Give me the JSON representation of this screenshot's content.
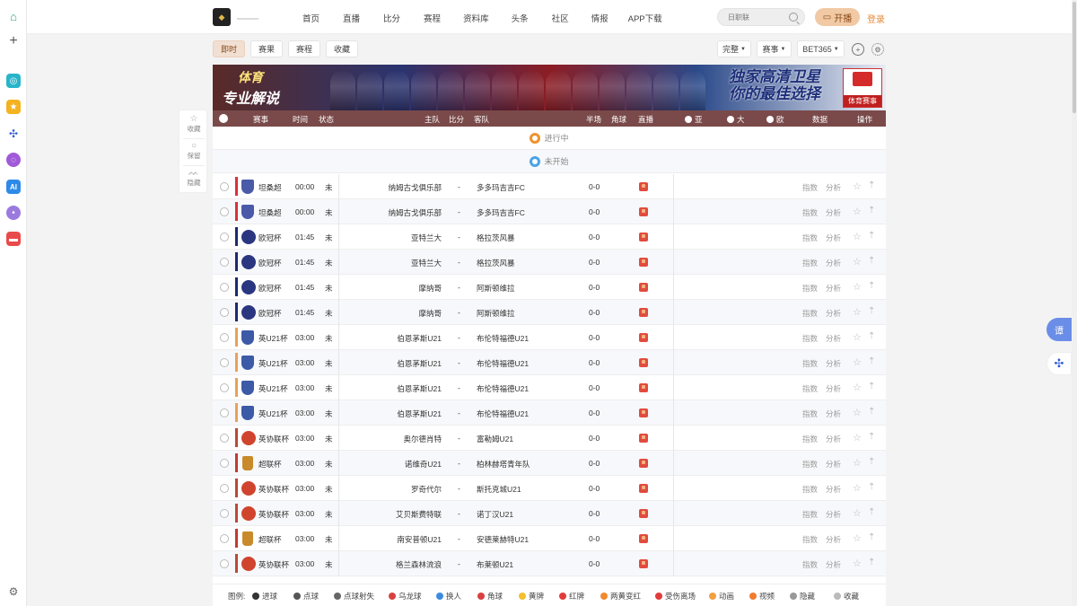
{
  "nav": [
    "首页",
    "直播",
    "比分",
    "赛程",
    "资料库",
    "头条",
    "社区",
    "情报",
    "APP下载"
  ],
  "search_placeholder": "日职联",
  "open_label": "开播",
  "login_label": "登录",
  "tabs": [
    "即时",
    "赛果",
    "赛程",
    "收藏"
  ],
  "selects": [
    "完整",
    "赛事",
    "BET365"
  ],
  "banner": {
    "left_top": "体育",
    "left_bottom": "专业解说",
    "right_line1": "独家高清卫星",
    "right_line2": "你的最佳选择",
    "brand": "体育赛事"
  },
  "header": {
    "league": "赛事",
    "time": "时间",
    "status": "状态",
    "home": "主队",
    "score": "比分",
    "away": "客队",
    "half": "半场",
    "corner": "角球",
    "live": "直播",
    "asia": "亚",
    "big": "大",
    "euro": "欧",
    "data": "数据",
    "ops": "操作"
  },
  "sections": {
    "live": "进行中",
    "upcoming": "未开始"
  },
  "row_common": {
    "status": "未",
    "score": "-",
    "half": "0-0",
    "index": "指数",
    "analysis": "分析"
  },
  "rows": [
    {
      "league": "坦桑超",
      "time": "00:00",
      "home": "纳姆古戈俱乐部",
      "away": "多多玛吉吉FC",
      "color": "#d8323a",
      "logo": "shield",
      "logo_color": "#4a5aa8"
    },
    {
      "league": "坦桑超",
      "time": "00:00",
      "home": "纳姆古戈俱乐部",
      "away": "多多玛吉吉FC",
      "color": "#d8323a",
      "logo": "shield",
      "logo_color": "#4a5aa8"
    },
    {
      "league": "欧冠杯",
      "time": "01:45",
      "home": "亚特兰大",
      "away": "格拉茨风暴",
      "color": "#1d2a6e",
      "logo": "round",
      "logo_color": "#2a3680"
    },
    {
      "league": "欧冠杯",
      "time": "01:45",
      "home": "亚特兰大",
      "away": "格拉茨风暴",
      "color": "#1d2a6e",
      "logo": "round",
      "logo_color": "#2a3680"
    },
    {
      "league": "欧冠杯",
      "time": "01:45",
      "home": "摩纳哥",
      "away": "阿斯顿维拉",
      "color": "#1d2a6e",
      "logo": "round",
      "logo_color": "#2a3680"
    },
    {
      "league": "欧冠杯",
      "time": "01:45",
      "home": "摩纳哥",
      "away": "阿斯顿维拉",
      "color": "#1d2a6e",
      "logo": "round",
      "logo_color": "#2a3680"
    },
    {
      "league": "英U21杯",
      "time": "03:00",
      "home": "伯恩茅斯U21",
      "away": "布伦特福德U21",
      "color": "#e8a25a",
      "logo": "shield",
      "logo_color": "#3d5aa6"
    },
    {
      "league": "英U21杯",
      "time": "03:00",
      "home": "伯恩茅斯U21",
      "away": "布伦特福德U21",
      "color": "#e8a25a",
      "logo": "shield",
      "logo_color": "#3d5aa6"
    },
    {
      "league": "英U21杯",
      "time": "03:00",
      "home": "伯恩茅斯U21",
      "away": "布伦特福德U21",
      "color": "#e8a25a",
      "logo": "shield",
      "logo_color": "#3d5aa6"
    },
    {
      "league": "英U21杯",
      "time": "03:00",
      "home": "伯恩茅斯U21",
      "away": "布伦特福德U21",
      "color": "#e8a25a",
      "logo": "shield",
      "logo_color": "#3d5aa6"
    },
    {
      "league": "英协联杯",
      "time": "03:00",
      "home": "奥尔德肖特",
      "away": "富勒姆U21",
      "color": "#b84a3a",
      "logo": "round",
      "logo_color": "#d0442e"
    },
    {
      "league": "超联杯",
      "time": "03:00",
      "home": "诺维奇U21",
      "away": "柏林赫塔青年队",
      "color": "#c33a2e",
      "logo": "cup",
      "logo_color": "#c88a2a"
    },
    {
      "league": "英协联杯",
      "time": "03:00",
      "home": "罗奇代尔",
      "away": "斯托克城U21",
      "color": "#b84a3a",
      "logo": "round",
      "logo_color": "#d0442e"
    },
    {
      "league": "英协联杯",
      "time": "03:00",
      "home": "艾贝斯费特联",
      "away": "诺丁汉U21",
      "color": "#b84a3a",
      "logo": "round",
      "logo_color": "#d0442e"
    },
    {
      "league": "超联杯",
      "time": "03:00",
      "home": "南安普顿U21",
      "away": "安德莱赫特U21",
      "color": "#c33a2e",
      "logo": "cup",
      "logo_color": "#c88a2a"
    },
    {
      "league": "英协联杯",
      "time": "03:00",
      "home": "格兰森林流浪",
      "away": "布莱顿U21",
      "color": "#b84a3a",
      "logo": "round",
      "logo_color": "#d0442e"
    }
  ],
  "legend": {
    "title": "图例:",
    "items": [
      {
        "label": "进球",
        "color": "#333333"
      },
      {
        "label": "点球",
        "color": "#555555"
      },
      {
        "label": "点球射失",
        "color": "#666666"
      },
      {
        "label": "乌龙球",
        "color": "#d94040"
      },
      {
        "label": "换人",
        "color": "#3c8be0"
      },
      {
        "label": "角球",
        "color": "#d94040"
      },
      {
        "label": "黄牌",
        "color": "#f2c12e"
      },
      {
        "label": "红牌",
        "color": "#e23b3b"
      },
      {
        "label": "两黄变红",
        "color": "#f08a2e"
      },
      {
        "label": "受伤离场",
        "color": "#e23b3b"
      },
      {
        "label": "动画",
        "color": "#f0a040"
      },
      {
        "label": "视频",
        "color": "#f07a30"
      },
      {
        "label": "隐藏",
        "color": "#999999"
      },
      {
        "label": "收藏",
        "color": "#bbbbbb"
      }
    ]
  },
  "float": {
    "fav": "收藏",
    "keep": "保留",
    "hide": "隐藏"
  },
  "rfloat_label": "谭"
}
